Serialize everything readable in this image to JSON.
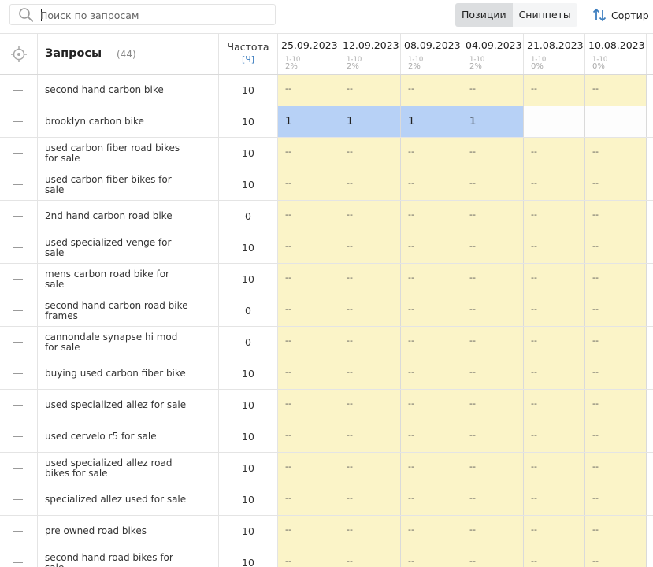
{
  "search": {
    "placeholder": "Поиск по запросам",
    "value": ""
  },
  "tabs": [
    {
      "label": "Позиции",
      "active": true
    },
    {
      "label": "Сниппеты",
      "active": false
    }
  ],
  "sort": {
    "label": "Сортир"
  },
  "table": {
    "queries_label": "Запросы",
    "queries_count": "(44)",
    "freq_label": "Частота",
    "freq_sub": "[Ч]",
    "dates": [
      {
        "date": "25.09.2023",
        "range": "1-10",
        "pct": "2%"
      },
      {
        "date": "12.09.2023",
        "range": "1-10",
        "pct": "2%"
      },
      {
        "date": "08.09.2023",
        "range": "1-10",
        "pct": "2%"
      },
      {
        "date": "04.09.2023",
        "range": "1-10",
        "pct": "2%"
      },
      {
        "date": "21.08.2023",
        "range": "1-10",
        "pct": "0%"
      },
      {
        "date": "10.08.2023",
        "range": "1-10",
        "pct": "0%"
      }
    ],
    "rows": [
      {
        "query": "second hand carbon bike",
        "freq": "10",
        "positions": [
          "--",
          "--",
          "--",
          "--",
          "--",
          "--"
        ]
      },
      {
        "query": "brooklyn carbon bike",
        "freq": "10",
        "positions": [
          "1",
          "1",
          "1",
          "1",
          "",
          ""
        ]
      },
      {
        "query": "used carbon fiber road bikes for sale",
        "freq": "10",
        "positions": [
          "--",
          "--",
          "--",
          "--",
          "--",
          "--"
        ]
      },
      {
        "query": "used carbon fiber bikes for sale",
        "freq": "10",
        "positions": [
          "--",
          "--",
          "--",
          "--",
          "--",
          "--"
        ]
      },
      {
        "query": "2nd hand carbon road bike",
        "freq": "0",
        "positions": [
          "--",
          "--",
          "--",
          "--",
          "--",
          "--"
        ]
      },
      {
        "query": "used specialized venge for sale",
        "freq": "10",
        "positions": [
          "--",
          "--",
          "--",
          "--",
          "--",
          "--"
        ]
      },
      {
        "query": "mens carbon road bike for sale",
        "freq": "10",
        "positions": [
          "--",
          "--",
          "--",
          "--",
          "--",
          "--"
        ]
      },
      {
        "query": "second hand carbon road bike frames",
        "freq": "0",
        "positions": [
          "--",
          "--",
          "--",
          "--",
          "--",
          "--"
        ]
      },
      {
        "query": "cannondale synapse hi mod for sale",
        "freq": "0",
        "positions": [
          "--",
          "--",
          "--",
          "--",
          "--",
          "--"
        ]
      },
      {
        "query": "buying used carbon fiber bike",
        "freq": "10",
        "positions": [
          "--",
          "--",
          "--",
          "--",
          "--",
          "--"
        ]
      },
      {
        "query": "used specialized allez for sale",
        "freq": "10",
        "positions": [
          "--",
          "--",
          "--",
          "--",
          "--",
          "--"
        ]
      },
      {
        "query": "used cervelo r5 for sale",
        "freq": "10",
        "positions": [
          "--",
          "--",
          "--",
          "--",
          "--",
          "--"
        ]
      },
      {
        "query": "used specialized allez road bikes for sale",
        "freq": "10",
        "positions": [
          "--",
          "--",
          "--",
          "--",
          "--",
          "--"
        ]
      },
      {
        "query": "specialized allez used for sale",
        "freq": "10",
        "positions": [
          "--",
          "--",
          "--",
          "--",
          "--",
          "--"
        ]
      },
      {
        "query": "pre owned road bikes",
        "freq": "10",
        "positions": [
          "--",
          "--",
          "--",
          "--",
          "--",
          "--"
        ]
      },
      {
        "query": "second hand road bikes for sale",
        "freq": "10",
        "positions": [
          "--",
          "--",
          "--",
          "--",
          "--",
          "--"
        ]
      }
    ]
  },
  "colors": {
    "position_cell": "#fbf4c8",
    "found_cell": "#b7d1f6",
    "accent": "#3d7ebf"
  }
}
